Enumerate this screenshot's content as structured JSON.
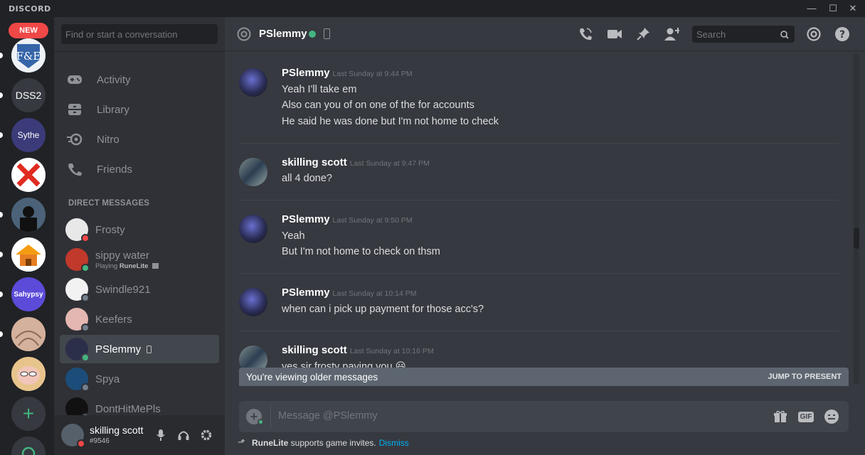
{
  "window": {
    "brand": "DISCORD",
    "minimize": "—",
    "maximize": "☐",
    "close": "✕"
  },
  "rail": {
    "new_badge": "NEW",
    "servers": [
      {
        "label": "F&E",
        "color": "#4a6fa5"
      },
      {
        "label": "DSS2",
        "color": "#36393f"
      },
      {
        "label": "Sythe",
        "color": "#3b3b7a"
      },
      {
        "label": "",
        "color": "#ffffff"
      },
      {
        "label": "",
        "color": "#34495e"
      },
      {
        "label": "",
        "color": "#f5a623"
      },
      {
        "label": "Sahypsy",
        "color": "#5b4bd8"
      },
      {
        "label": "",
        "color": "#c9a08a"
      },
      {
        "label": "",
        "color": "#d9a86c"
      }
    ],
    "add_server": "+"
  },
  "sidebar": {
    "search_placeholder": "Find or start a conversation",
    "nav": [
      {
        "label": "Activity",
        "icon": "controller-icon"
      },
      {
        "label": "Library",
        "icon": "library-icon"
      },
      {
        "label": "Nitro",
        "icon": "nitro-icon"
      },
      {
        "label": "Friends",
        "icon": "friends-icon"
      }
    ],
    "dm_header": "DIRECT MESSAGES",
    "dms": [
      {
        "name": "Frosty",
        "status": "#f04747",
        "avatar": "#e8e8e8"
      },
      {
        "name": "sippy water",
        "sub_prefix": "Playing ",
        "sub_game": "RuneLite",
        "status": "#43b581",
        "avatar": "#c0392b"
      },
      {
        "name": "Swindle921",
        "status": "#747f8d",
        "avatar": "#f2f2f2"
      },
      {
        "name": "Keefers",
        "status": "#747f8d",
        "avatar": "#e4b7b2"
      },
      {
        "name": "PSlemmy",
        "status": "#43b581",
        "avatar": "#2c2f4a"
      },
      {
        "name": "Spya",
        "status": "#747f8d",
        "avatar": "#1c4d7a"
      },
      {
        "name": "DontHitMePls",
        "status": "#747f8d",
        "avatar": "#111111"
      }
    ],
    "user": {
      "name": "skilling scott",
      "tag": "#9546"
    }
  },
  "header": {
    "name": "PSlemmy",
    "search_placeholder": "Search"
  },
  "messages": [
    {
      "author": "PSlemmy",
      "time": "Last Sunday at 9:44 PM",
      "lines": [
        "Yeah I'll take em",
        "Also can you of on one of the for accounts",
        "He said he was done but I'm not home to check"
      ]
    },
    {
      "author": "skilling scott",
      "time": "Last Sunday at 9:47 PM",
      "lines": [
        "all 4 done?"
      ]
    },
    {
      "author": "PSlemmy",
      "time": "Last Sunday at 9:50 PM",
      "lines": [
        "Yeah",
        "But I'm not home to check on thsm"
      ]
    },
    {
      "author": "PSlemmy",
      "time": "Last Sunday at 10:14 PM",
      "lines": [
        "when can i pick up payment for those acc's?"
      ]
    },
    {
      "author": "skilling scott",
      "time": "Last Sunday at 10:16 PM",
      "lines": [
        "yes sir frosty paying you 😃"
      ]
    }
  ],
  "older_bar": {
    "text": "You're viewing older messages",
    "jump": "JUMP TO PRESENT"
  },
  "composer": {
    "placeholder": "Message @PSlemmy",
    "gif": "GIF"
  },
  "notice": {
    "game": "RuneLite",
    "text": " supports game invites.",
    "dismiss": "Dismiss"
  }
}
